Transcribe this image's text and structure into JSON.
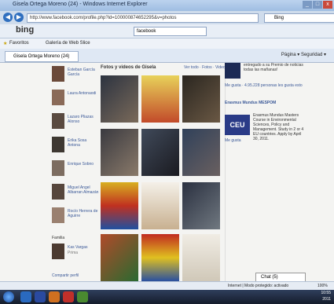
{
  "window": {
    "title": "Gisela Ortega Moreno (24) - Windows Internet Explorer",
    "controls": [
      "_",
      "□",
      "x"
    ]
  },
  "address": {
    "url": "http://www.facebook.com/profile.php?id=100000874652295&v=photos",
    "search_engine": "Bing"
  },
  "bing": {
    "logo": "bing",
    "query": "facebook"
  },
  "favorites": {
    "label": "Favoritos",
    "gallery": "Galería de Web Slice"
  },
  "tab": {
    "title": "Gisela Ortega Moreno (24)"
  },
  "commandbar": {
    "page": "Página",
    "safety": "Seguridad"
  },
  "friends": [
    {
      "name": "Esteban García García"
    },
    {
      "name": "Laura Antonaodi"
    },
    {
      "name": "Lazaro Pliazas Alonso"
    },
    {
      "name": "Erika Sosa Antona"
    },
    {
      "name": "Enrique Sobno"
    },
    {
      "name": "Miguel Angel Albarran Almazán"
    },
    {
      "name": "Rocío Herrera de Aguirre"
    }
  ],
  "family": {
    "label": "Familia",
    "member": "Kas Vargas",
    "relation": "Prima"
  },
  "share_profile": "Compartir perfil",
  "photos": {
    "header": "Fotos y videos de Gisela",
    "links": "Ver todo · Fotos · Video",
    "grid_count": 12
  },
  "right_col": {
    "top_text": "entregado a su Premio de noticias todas las mañanas!",
    "like": "Me gusta · 4.95.228 personas les gusta esto",
    "ad_title": "Erasmus Mundus MESPOM",
    "ad_body": "Erasmus Mundus Masters Course in Environmental Sciences, Policy and Management. Study in 2 or 4 EU countries. Apply by April 30, 2011.",
    "ad_logo": "CEU",
    "ad_like": "Me gusta",
    "chat": "Chat (5)"
  },
  "status": {
    "text": "Internet | Modo protegido: activado",
    "zoom": "100%"
  },
  "taskbar": {
    "clock": "10:55",
    "date": "2011"
  },
  "colors": {
    "facebook_blue": "#3b5998",
    "titlebar": "#9fbde2",
    "taskbar": "#151c2b"
  }
}
